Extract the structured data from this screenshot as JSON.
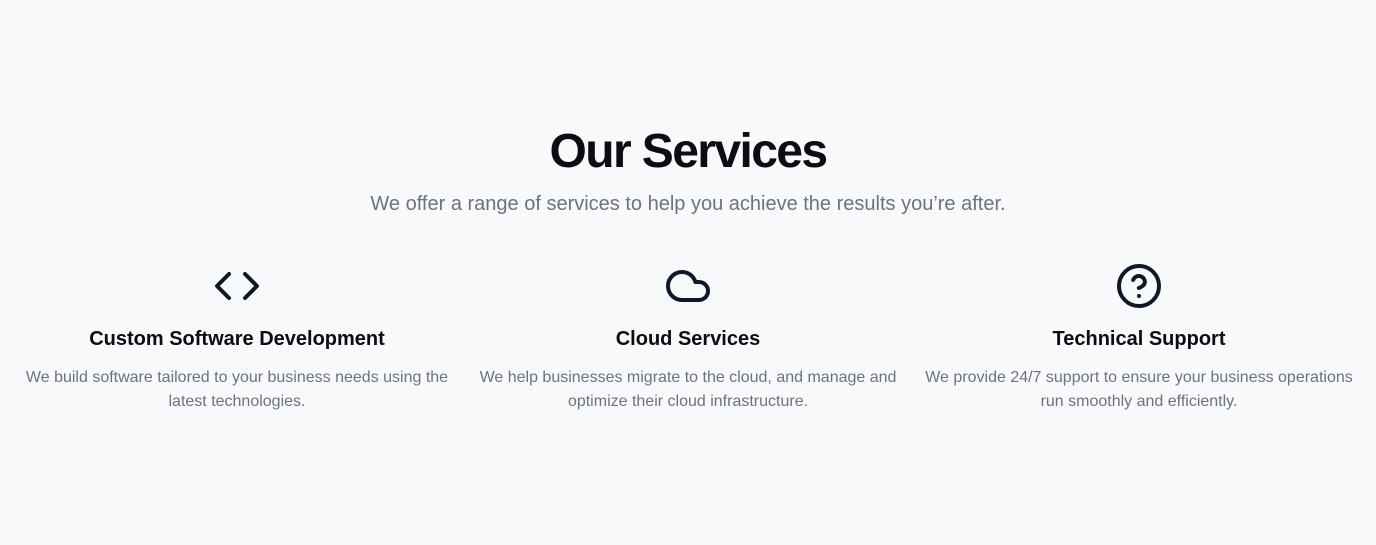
{
  "header": {
    "title": "Our Services",
    "subtitle": "We offer a range of services to help you achieve the results you’re after."
  },
  "services": [
    {
      "icon": "code-icon",
      "title": "Custom Software Development",
      "description": "We build software tailored to your business needs using the latest technologies."
    },
    {
      "icon": "cloud-icon",
      "title": "Cloud Services",
      "description": "We help businesses migrate to the cloud, and manage and optimize their cloud infrastructure."
    },
    {
      "icon": "help-circle-icon",
      "title": "Technical Support",
      "description": "We provide 24/7 support to ensure your business operations run smoothly and efficiently."
    }
  ],
  "colors": {
    "background": "#f8f9fb",
    "heading": "#0b0d12",
    "muted_text": "#6b7280",
    "icon_stroke": "#0f172a"
  }
}
